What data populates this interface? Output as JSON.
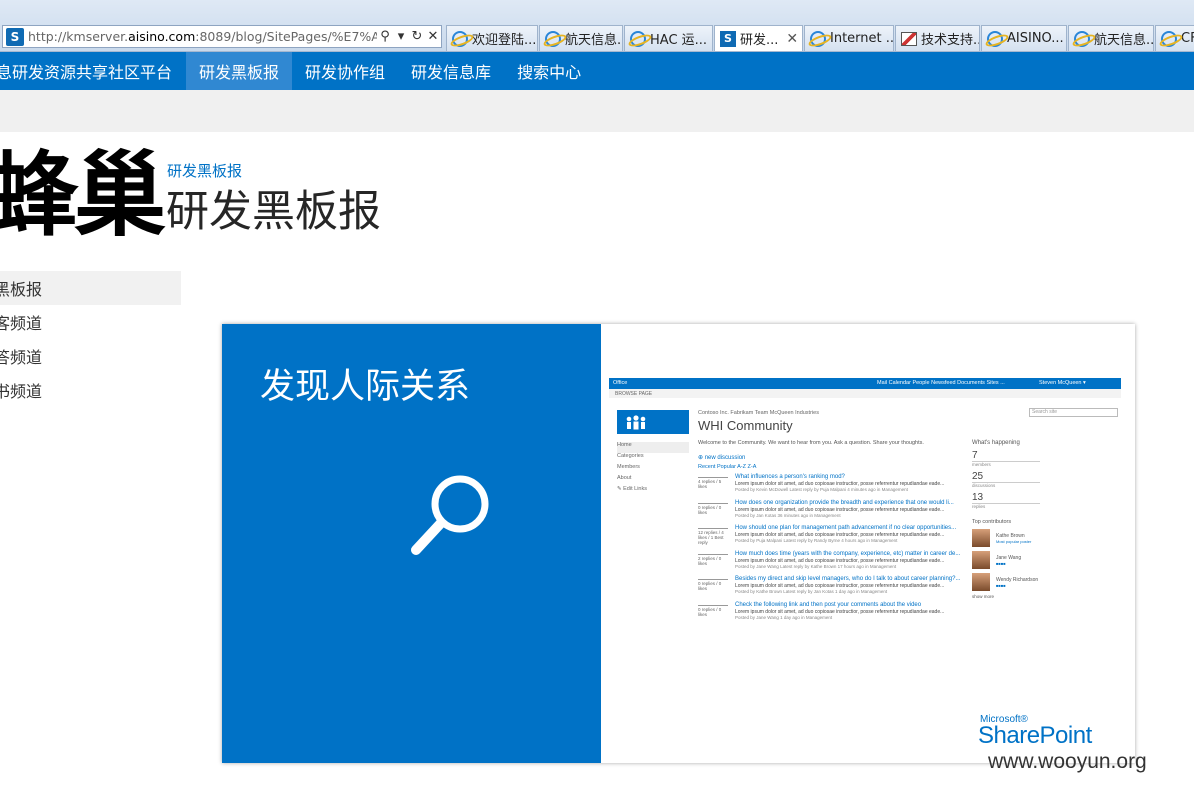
{
  "browser": {
    "url_prefix": "http://kmserver.",
    "url_host": "aisino.com",
    "url_rest": ":8089/blog/SitePages/%E7%A0%",
    "search_icon": "search-icon",
    "dropdown_icon": "chevron-down-icon",
    "refresh_icon": "refresh-icon",
    "stop_icon": "close-icon",
    "tabs": [
      {
        "label": "欢迎登陆...",
        "icon": "ie-icon"
      },
      {
        "label": "航天信息...",
        "icon": "ie-icon"
      },
      {
        "label": "HAC 运...",
        "icon": "ie-icon"
      },
      {
        "label": "研发...",
        "icon": "sharepoint-icon",
        "active": true
      },
      {
        "label": "Internet ...",
        "icon": "ie-icon"
      },
      {
        "label": "技术支持...",
        "icon": "image-icon"
      },
      {
        "label": "AISINO...",
        "icon": "ie-icon"
      },
      {
        "label": "航天信息...",
        "icon": "ie-icon"
      },
      {
        "label": "CF",
        "icon": "ie-icon"
      }
    ]
  },
  "nav": {
    "items": [
      "息研发资源共享社区平台",
      "研发黑板报",
      "研发协作组",
      "研发信息库",
      "搜索中心"
    ],
    "selected_index": 1,
    "color": "#0072c6"
  },
  "header": {
    "logo_text": "蜂巢",
    "breadcrumb": "研发黑板报",
    "title": "研发黑板报"
  },
  "quick_launch": [
    "黑板报",
    "客频道",
    "答频道",
    "书频道"
  ],
  "hero": {
    "heading": "发现人际关系",
    "mock": {
      "suite_left": "Office",
      "suite_links": "Mail  Calendar  People  Newsfeed  Documents  Sites  ...",
      "user": "Steven McQueen ▾",
      "sub_left": "BROWSE  PAGE",
      "crumbs": "Contoso Inc.   Fabrikam Team   McQueen Industries",
      "title": "WHI Community",
      "search_placeholder": "Search site",
      "left_nav": [
        "Home",
        "Categories",
        "Members",
        "About",
        "✎ Edit Links"
      ],
      "welcome": "Welcome to the Community. We want to hear from you. Ask a question. Share your thoughts.",
      "new_discussion": "⊕  new discussion",
      "filters": "Recent   Popular   A-Z   Z-A",
      "rows": [
        {
          "stats": "4 replies / 5 likes",
          "q": "What influences a person's ranking mod?",
          "meta": "Posted by Kevin McDowell  Latest reply by Puja Malpani 4 minutes ago in Management"
        },
        {
          "stats": "0 replies / 0 likes",
          "q": "How does one organization provide the breadth and experience that one would li...",
          "meta": "Posted by Jan Kotas 36 minutes ago in Management"
        },
        {
          "stats": "12 replies / 4 likes / 1 Best reply",
          "q": "How should one plan for management path advancement if no clear opportunities...",
          "meta": "Posted by Puja Malpani  Latest reply by Randy Byrne 4 hours ago in Management"
        },
        {
          "stats": "2 replies / 0 likes",
          "q": "How much does time (years with the company, experience, etc) matter in career de...",
          "meta": "Posted by Jane Wang  Latest reply by Kathe Brown 17 hours ago in Management"
        },
        {
          "stats": "0 replies / 0 likes",
          "q": "Besides my direct and skip level managers, who do I talk to about career planning?...",
          "meta": "Posted by Kathe Brown  Latest reply by Jan Kotas 1 day ago in Management"
        },
        {
          "stats": "0 replies / 0 likes",
          "q": "Check the following link and then post your comments about the video",
          "meta": "Posted by Jane Wang 1 day ago in Management"
        }
      ],
      "row_body": "Lorem ipsum dolor sit amet, ad duo copiosae instructior, posse referrentur repudiandae eade...",
      "happening_label": "What's happening",
      "stats": [
        {
          "value": "7",
          "label": "members"
        },
        {
          "value": "25",
          "label": "discussions"
        },
        {
          "value": "13",
          "label": "replies"
        }
      ],
      "contributors_label": "Top contributors",
      "contributors": [
        {
          "name": "Kathe Brown",
          "note": "Most popular poster"
        },
        {
          "name": "Jane Wang",
          "note": "■■■■"
        },
        {
          "name": "Wendy Richardson",
          "note": "■■■■"
        }
      ],
      "show_more": "show more"
    },
    "brand_small": "Microsoft®",
    "brand_large": "SharePoint"
  },
  "watermark": "www.wooyun.org"
}
